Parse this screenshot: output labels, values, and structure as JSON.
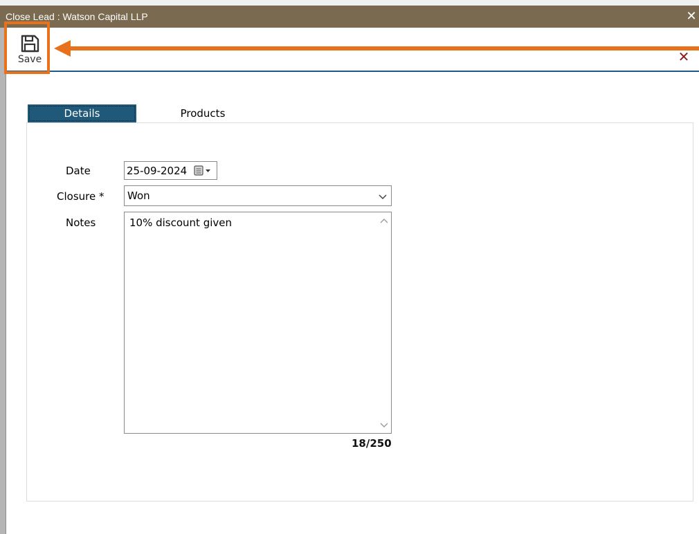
{
  "window": {
    "title": "Close Lead : Watson Capital LLP",
    "close_glyph": "✕"
  },
  "toolbar": {
    "save_label": "Save",
    "save_icon": "floppy-disk-icon",
    "form_close_glyph": "✕",
    "form_close_icon": "close-icon"
  },
  "annotation": {
    "highlight_color": "#e8711c",
    "arrow_direction": "left"
  },
  "tabs": [
    {
      "label": "Details",
      "active": true
    },
    {
      "label": "Products",
      "active": false
    }
  ],
  "form": {
    "date_label": "Date",
    "date_value": "25-09-2024",
    "date_picker_icon": "calendar-dropdown-icon",
    "closure_label": "Closure *",
    "closure_value": "Won",
    "closure_chevron_icon": "chevron-down-icon",
    "notes_label": "Notes",
    "notes_value": "10% discount given",
    "notes_counter": "18/250"
  },
  "colors": {
    "titlebar": "#7a6a4f",
    "accent": "#1f5878",
    "annotation": "#e8711c"
  }
}
